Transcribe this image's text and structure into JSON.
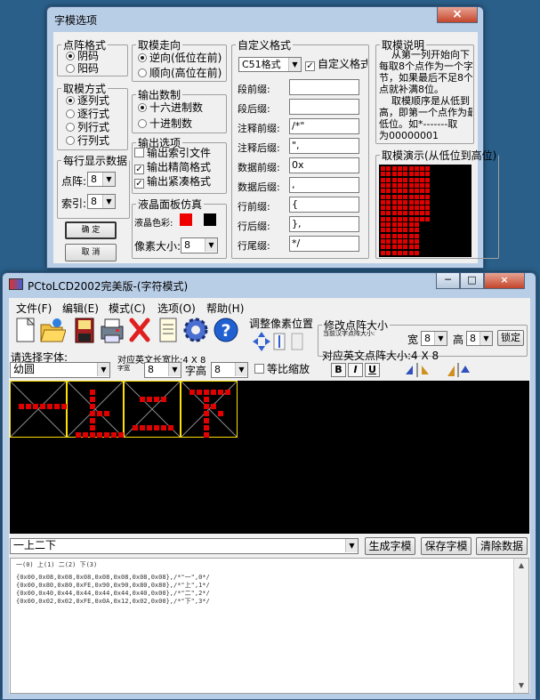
{
  "dialog": {
    "title": "字模选项",
    "close": "×",
    "dot_format": {
      "legend": "点阵格式",
      "options": [
        "阴码",
        "阳码"
      ],
      "selected": 0
    },
    "scan_mode": {
      "legend": "取模方式",
      "options": [
        "逐列式",
        "逐行式",
        "列行式",
        "行列式"
      ],
      "selected": 0
    },
    "per_line": {
      "legend": "每行显示数据",
      "dot_label": "点阵:",
      "dot_value": "8",
      "index_label": "索引:",
      "index_value": "8"
    },
    "ok_button": "确  定",
    "cancel_button": "取  消",
    "direction": {
      "legend": "取模走向",
      "options": [
        "逆向(低位在前)",
        "顺向(高位在前)"
      ],
      "selected": 0
    },
    "number_format": {
      "legend": "输出数制",
      "options": [
        "十六进制数",
        "十进制数"
      ],
      "selected": 0
    },
    "output_options": {
      "legend": "输出选项",
      "items": [
        {
          "label": "输出索引文件",
          "checked": false
        },
        {
          "label": "输出精简格式",
          "checked": true
        },
        {
          "label": "输出紧凑格式",
          "checked": true
        }
      ]
    },
    "lcd_sim": {
      "legend": "液晶面板仿真",
      "color_label": "液晶色彩:",
      "pixel_label": "像素大小:",
      "pixel_value": "8",
      "fg_color": "#ee0000",
      "bg_color": "#000000"
    },
    "custom": {
      "legend": "自定义格式",
      "format_value": "C51格式",
      "custom_checkbox": "自定义格式",
      "custom_checked": true,
      "fields": [
        {
          "label": "段前缀:",
          "value": ""
        },
        {
          "label": "段后缀:",
          "value": ""
        },
        {
          "label": "注释前缀:",
          "value": "/*\""
        },
        {
          "label": "注释后缀:",
          "value": "\","
        },
        {
          "label": "数据前缀:",
          "value": "0x"
        },
        {
          "label": "数据后缀:",
          "value": ","
        },
        {
          "label": "行前缀:",
          "value": "{"
        },
        {
          "label": "行后缀:",
          "value": "},"
        },
        {
          "label": "行尾缀:",
          "value": "*/"
        }
      ]
    },
    "explain": {
      "legend": "取模说明",
      "text": [
        "    从第一列开始向下",
        "每取8个点作为一个字",
        "节，如果最后不足8个",
        "点就补满8位。",
        "    取模顺序是从低到",
        "高，即第一个点作为最",
        "低位。如*-------取",
        "为00000001"
      ]
    },
    "demo": {
      "legend": "取模演示(从低位到高位)"
    }
  },
  "main": {
    "title": "PCtoLCD2002完美版-(字符模式)",
    "window_buttons": [
      "─",
      "□",
      "×"
    ],
    "menu": [
      "文件(F)",
      "编辑(E)",
      "模式(C)",
      "选项(O)",
      "帮助(H)"
    ],
    "toolbar_icons": [
      "new-icon",
      "open-icon",
      "save-icon",
      "print-icon",
      "delete-icon",
      "notes-icon",
      "settings-gear-icon",
      "help-icon"
    ],
    "adjust_label": "调整像素位置",
    "resize": {
      "legend": "修改点阵大小",
      "hint": "当前汉字点阵大小:",
      "width_label": "宽",
      "width": "8",
      "height_label": "高",
      "height": "8",
      "lock": "锁定"
    },
    "font_label": "请选择字体:",
    "font_value": "幼圆",
    "cn_size_label": "对应英文长宽比:4 X 8",
    "en_size_label": "对应英文点阵大小:4 X 8",
    "char_size_label": "字宽",
    "char_width": "8",
    "char_height_label": "字高",
    "char_height": "8",
    "proportional": "等比缩放",
    "format_buttons": [
      "B",
      "I",
      "U"
    ],
    "input_text": "一上二下",
    "generate": "生成字模",
    "save": "保存字模",
    "clear": "清除数据",
    "output_header": "一(0)  上(1)  二(2)  下(3)",
    "output_lines": [
      "{0x00,0x08,0x08,0x08,0x08,0x08,0x08,0x08},/*\"一\",0*/",
      "{0x00,0x80,0x80,0xFE,0x90,0x90,0x80,0x80},/*\"上\",1*/",
      "{0x00,0x40,0x44,0x44,0x44,0x44,0x40,0x00},/*\"二\",2*/",
      "{0x00,0x02,0x02,0xFE,0x0A,0x12,0x02,0x00},/*\"下\",3*/"
    ],
    "glyphs": [
      "0x00,0x08,0x08,0x08,0x08,0x08,0x08,0x08",
      "0x00,0x80,0x80,0xFE,0x90,0x90,0x80,0x80",
      "0x00,0x40,0x44,0x44,0x44,0x44,0x40,0x00",
      "0x00,0x02,0x02,0xFE,0x0A,0x12,0x02,0x00"
    ]
  }
}
